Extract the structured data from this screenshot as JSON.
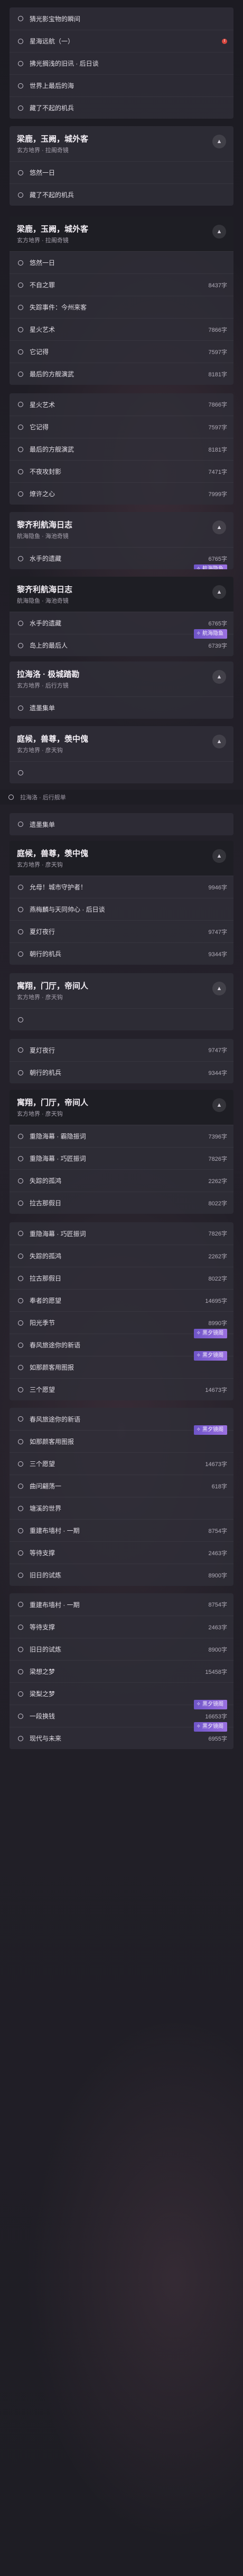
{
  "icons": {
    "chevron": "chevron-up-icon",
    "bullet": "circle-bullet-icon",
    "badge": "sparkle-icon",
    "alert": "alert-dot-icon"
  },
  "colors": {
    "badge": "#8a66d9",
    "alert": "#d8473f",
    "panel": "#302e38"
  },
  "sections": [
    {
      "title": "",
      "sub": "",
      "rows": [
        {
          "label": "猜光影宝物的瞬间",
          "count": ""
        },
        {
          "label": "星海远航（一）",
          "count": "",
          "alert": true
        },
        {
          "label": "拂光搁浅的旧讯 · 后日谈",
          "count": ""
        },
        {
          "label": "世界上最后的海",
          "count": ""
        },
        {
          "label": "藏了不起的机兵",
          "count": ""
        }
      ]
    },
    {
      "title": "梁鹿，玉阙，城外客",
      "sub": "玄方地界 · 拉阁奇镜",
      "hdr": "light",
      "rows": [
        {
          "label": "悠然一日",
          "count": ""
        },
        {
          "label": "藏了不起的机兵",
          "count": ""
        }
      ]
    },
    {
      "title": "梁鹿，玉阙，城外客",
      "sub": "玄方地界 · 拉阁奇镜",
      "hdr": "dark",
      "rows": [
        {
          "label": "悠然一日",
          "count": ""
        },
        {
          "label": "不自之罪",
          "count": "8437字"
        },
        {
          "label": "失踪事件：今州来客",
          "count": ""
        },
        {
          "label": "星火艺术",
          "count": "7866字"
        },
        {
          "label": "它记得",
          "count": "7597字"
        },
        {
          "label": "最后的方舰演武",
          "count": "8181字"
        }
      ]
    },
    {
      "title": "",
      "sub": "",
      "rows": [
        {
          "label": "星火艺术",
          "count": "7866字"
        },
        {
          "label": "它记得",
          "count": "7597字"
        },
        {
          "label": "最后的方舰演武",
          "count": "8181字"
        },
        {
          "label": "不夜攻封影",
          "count": "7471字"
        },
        {
          "label": "燎许之心",
          "count": "7999字"
        }
      ]
    },
    {
      "title": "黎齐利航海日志",
      "sub": "航海隐鱼 · 海池奇镜",
      "hdr": "light",
      "rows": [
        {
          "label": "水手的遗藏",
          "count": "6765字",
          "badge": "航海隐鱼"
        }
      ]
    },
    {
      "title": "黎齐利航海日志",
      "sub": "航海隐鱼 · 海池奇镜",
      "hdr": "dark",
      "rows": [
        {
          "label": "水手的遗藏",
          "count": "6765字",
          "badge": "航海隐鱼"
        },
        {
          "label": "岛上的最后人",
          "count": "6739字"
        }
      ]
    },
    {
      "title": "拉海洛 · 极城踏勘",
      "sub": "玄方地界 · 后行方镜",
      "hdr": "light",
      "rows": [
        {
          "label": "遗墨集单",
          "count": ""
        }
      ]
    },
    {
      "title": "庭候，兽尊，羡中傀",
      "sub": "玄方地界 · 彦天钩",
      "hdr": "light",
      "rows": [
        {
          "label": "",
          "count": ""
        }
      ]
    },
    {
      "title": "",
      "sub": "",
      "flush": true,
      "tail": true,
      "rows": [
        {
          "label": "拉海洛 · 后行舰单",
          "count": ""
        }
      ]
    },
    {
      "title": "",
      "sub": "",
      "rows": [
        {
          "label": "遗墨集单",
          "count": ""
        }
      ]
    },
    {
      "title": "庭候，兽尊，羡中傀",
      "sub": "玄方地界 · 彦天钩",
      "hdr": "dark",
      "rows": [
        {
          "label": "允母！城市守护者！",
          "count": "9946字"
        },
        {
          "label": "燕梅麟与天同帅心 · 后日谈",
          "count": ""
        },
        {
          "label": "夏灯夜行",
          "count": "9747字"
        },
        {
          "label": "朝行的机兵",
          "count": "9344字"
        }
      ]
    },
    {
      "title": "寓翔，门厅，帝间人",
      "sub": "玄方地界 · 彦天钩",
      "hdr": "light",
      "rows": [
        {
          "label": "",
          "count": ""
        }
      ]
    },
    {
      "title": "",
      "sub": "",
      "rows": [
        {
          "label": "夏灯夜行",
          "count": "9747字"
        },
        {
          "label": "朝行的机兵",
          "count": "9344字"
        }
      ]
    },
    {
      "title": "寓翔，门厅，帝间人",
      "sub": "玄方地界 · 彦天钩",
      "hdr": "dark",
      "rows": [
        {
          "label": "重隐海幕 · 霸隐振词",
          "count": "7396字"
        },
        {
          "label": "重隐海幕 · 巧匠振词",
          "count": "7826字"
        },
        {
          "label": "失踪的孤鸿",
          "count": "2262字"
        },
        {
          "label": "拉古那假日",
          "count": "8022字"
        }
      ]
    },
    {
      "title": "",
      "sub": "",
      "rows": [
        {
          "label": "重隐海幕 · 巧匠振词",
          "count": "7826字"
        },
        {
          "label": "失踪的孤鸿",
          "count": "2262字"
        },
        {
          "label": "拉古那假日",
          "count": "8022字"
        },
        {
          "label": "奉者的愿望",
          "count": "14695字"
        },
        {
          "label": "阳光季节",
          "count": "8990字",
          "badge": "黑夕镜阁"
        },
        {
          "label": "春风旅途你的新语",
          "count": "",
          "badge": "黑夕镜阁"
        },
        {
          "label": "如那颜客用图报",
          "count": ""
        },
        {
          "label": "三个愿望",
          "count": "14673字"
        }
      ]
    },
    {
      "title": "",
      "sub": "",
      "rows": [
        {
          "label": "春风旅途你的新语",
          "count": "",
          "badge": "黑夕镜阁"
        },
        {
          "label": "如那颜客用图报",
          "count": ""
        },
        {
          "label": "三个愿望",
          "count": "14673字"
        },
        {
          "label": "曲问翩荡一",
          "count": "618字"
        },
        {
          "label": "塘溪的世界",
          "count": ""
        },
        {
          "label": "重建布墙村 · 一期",
          "count": "8754字"
        },
        {
          "label": "等待支撑",
          "count": "2463字"
        },
        {
          "label": "旧日的试炼",
          "count": "8900字"
        }
      ]
    },
    {
      "title": "",
      "sub": "",
      "rows": [
        {
          "label": "重建布墙村 · 一期",
          "count": "8754字"
        },
        {
          "label": "等待支撑",
          "count": "2463字"
        },
        {
          "label": "旧日的试炼",
          "count": "8900字"
        },
        {
          "label": "梁想之梦",
          "count": "15458字"
        },
        {
          "label": "梁梨之梦",
          "count": "",
          "badge": "黑夕镜阁"
        },
        {
          "label": "一段换钱",
          "count": "16653字",
          "badge": "黑夕镜阁"
        },
        {
          "label": "现代与未来",
          "count": "6955字"
        }
      ]
    }
  ]
}
